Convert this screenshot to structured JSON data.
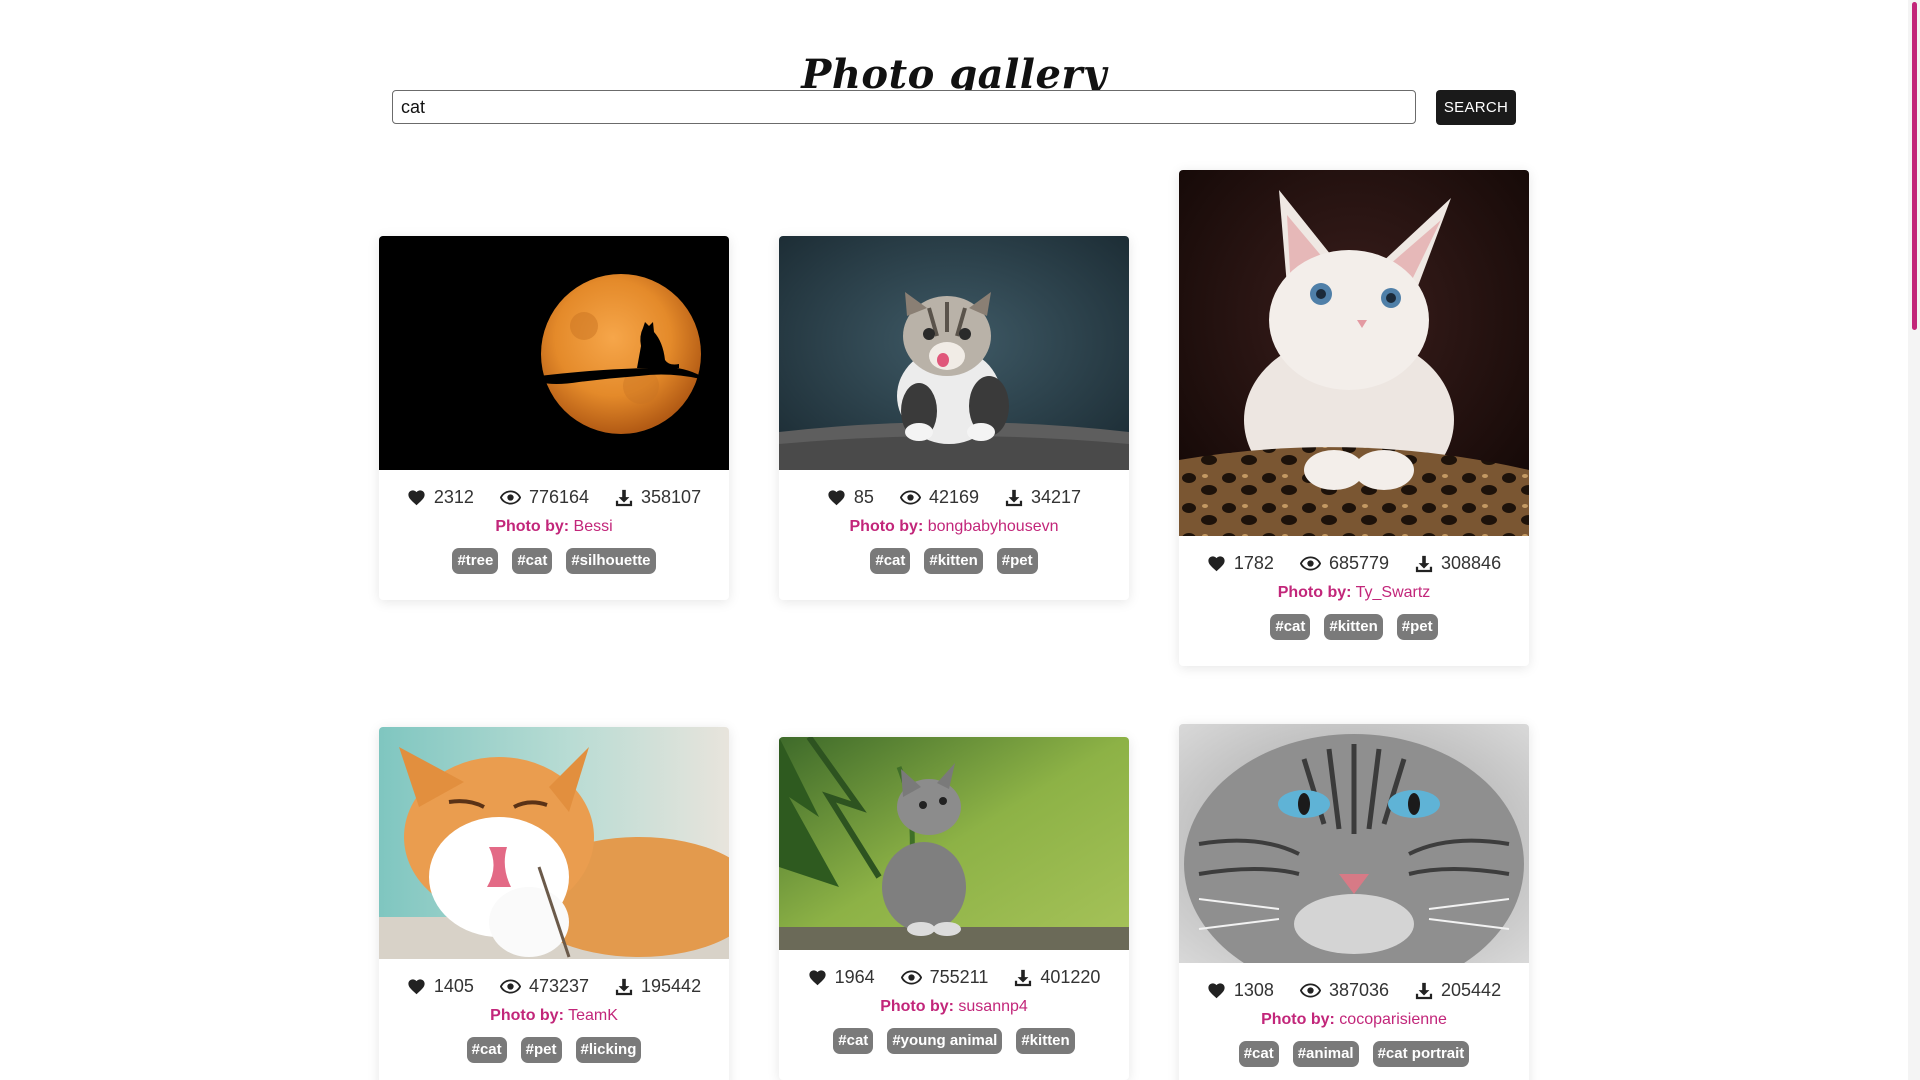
{
  "page": {
    "title": "Photo gallery"
  },
  "search": {
    "value": "cat",
    "button_label": "SEARCH"
  },
  "author_label": "Photo by:",
  "colors": {
    "accent": "#c2267a",
    "tag_bg": "#7a7a7a",
    "button_bg": "#1a1a1a"
  },
  "icons": {
    "likes": "heart-icon",
    "views": "eye-icon",
    "downloads": "download-icon"
  },
  "photos": [
    {
      "likes": "2312",
      "views": "776164",
      "downloads": "358107",
      "author": "Bessi",
      "tags": [
        "#tree",
        "#cat",
        "#silhouette"
      ],
      "subject": "cat silhouette on branch against full orange moon"
    },
    {
      "likes": "85",
      "views": "42169",
      "downloads": "34217",
      "author": "bongbabyhousevn",
      "tags": [
        "#cat",
        "#kitten",
        "#pet"
      ],
      "subject": "tabby kitten licking its nose on a sofa"
    },
    {
      "likes": "1782",
      "views": "685779",
      "downloads": "308846",
      "author": "Ty_Swartz",
      "tags": [
        "#cat",
        "#kitten",
        "#pet"
      ],
      "subject": "white kitten with blue eyes in leopard print bed"
    },
    {
      "likes": "1405",
      "views": "473237",
      "downloads": "195442",
      "author": "TeamK",
      "tags": [
        "#cat",
        "#pet",
        "#licking"
      ],
      "subject": "orange and white cat licking its paw"
    },
    {
      "likes": "1964",
      "views": "755211",
      "downloads": "401220",
      "author": "susannp4",
      "tags": [
        "#cat",
        "#young animal",
        "#kitten"
      ],
      "subject": "grey kitten sitting in green grass"
    },
    {
      "likes": "1308",
      "views": "387036",
      "downloads": "205442",
      "author": "cocoparisienne",
      "tags": [
        "#cat",
        "#animal",
        "#cat portrait"
      ],
      "subject": "grey tabby cat face with blue eyes"
    }
  ]
}
